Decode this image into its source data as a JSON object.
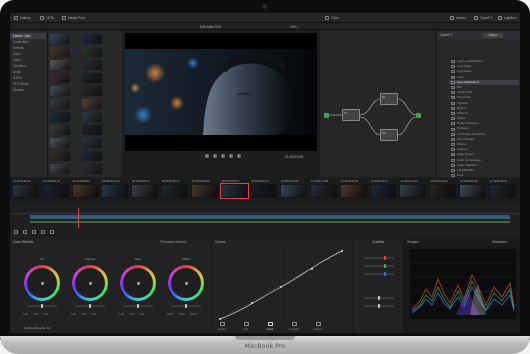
{
  "device": {
    "brand": "MacBook Pro"
  },
  "topbar": {
    "gallery": "Gallery",
    "luts": "LUTs",
    "media_pool": "Media Pool",
    "clips": "Clips",
    "nodes": "Nodes",
    "openfx": "OpenFX",
    "lightbox": "Lightbox"
  },
  "viewer": {
    "project_title": "Edit Main Roll",
    "timecode": "01:00:23:08",
    "zoom": "44%"
  },
  "media_pool": {
    "bins": [
      "Master Clips",
      "Smart Bins",
      "Selects",
      "Day 1",
      "Day 2",
      "Timelines",
      "Audio",
      "B-Roll",
      "VFX Shots",
      "Grades"
    ],
    "selected_index": 0
  },
  "library": {
    "title": "OpenFX",
    "tab_active": "Filters",
    "items": [
      "Aperture Diffraction",
      "Lens Flare",
      "Light Rays",
      "Glow",
      "Lens Reflections",
      "Blur",
      "Mosaic Blur",
      "Film Grain",
      "Vignette",
      "Beauty",
      "Sharpen",
      "Soften",
      "Noise Reduction",
      "Deflicker",
      "Chromatic Aberration",
      "Film Damage",
      "Warper",
      "Emboss",
      "Edge Detect",
      "Color Compressor",
      "Color Stabilizer",
      "Tilt-Shift Blur",
      "Dent",
      "Ripple"
    ],
    "selected_index": 4
  },
  "timeline": {
    "clip_labels": [
      "01 00:00:00:00",
      "02 00:00:01:12",
      "03 00:00:02:20",
      "04 00:00:04:02",
      "05 00:00:05:14",
      "06 00:00:06:22",
      "07 00:00:08:04",
      "08 00:00:09:16",
      "09 00:00:10:24",
      "10 00:00:12:06",
      "11 00:00:13:18",
      "12 00:00:15:00",
      "13 00:00:16:12",
      "14 00:00:17:24",
      "15 00:00:19:06",
      "16 00:00:20:18",
      "17 00:00:22:00"
    ]
  },
  "color": {
    "panel_title": "Color Wheels",
    "mode": "Primaries Wheels",
    "curves_title": "Curves",
    "qualifier_title": "Qualifier",
    "scopes_title": "Scopes",
    "waveform_title": "Waveform",
    "wheels": [
      {
        "name": "Lift",
        "vals": [
          "0.00",
          "0.00",
          "0.00"
        ]
      },
      {
        "name": "Gamma",
        "vals": [
          "0.00",
          "0.00",
          "0.00"
        ]
      },
      {
        "name": "Gain",
        "vals": [
          "1.00",
          "1.00",
          "1.00"
        ]
      },
      {
        "name": "Offset",
        "vals": [
          "25.00",
          "25.00",
          "25.00"
        ]
      }
    ],
    "bottom_status": "DaVinci Resolve 14"
  },
  "pages": {
    "items": [
      "Media",
      "Edit",
      "Color",
      "Fairlight",
      "Deliver"
    ],
    "active_index": 2
  },
  "colors": {
    "accent": "#e0433a",
    "node_green": "#4ea34e",
    "ui_bg": "#1d1d1f"
  }
}
